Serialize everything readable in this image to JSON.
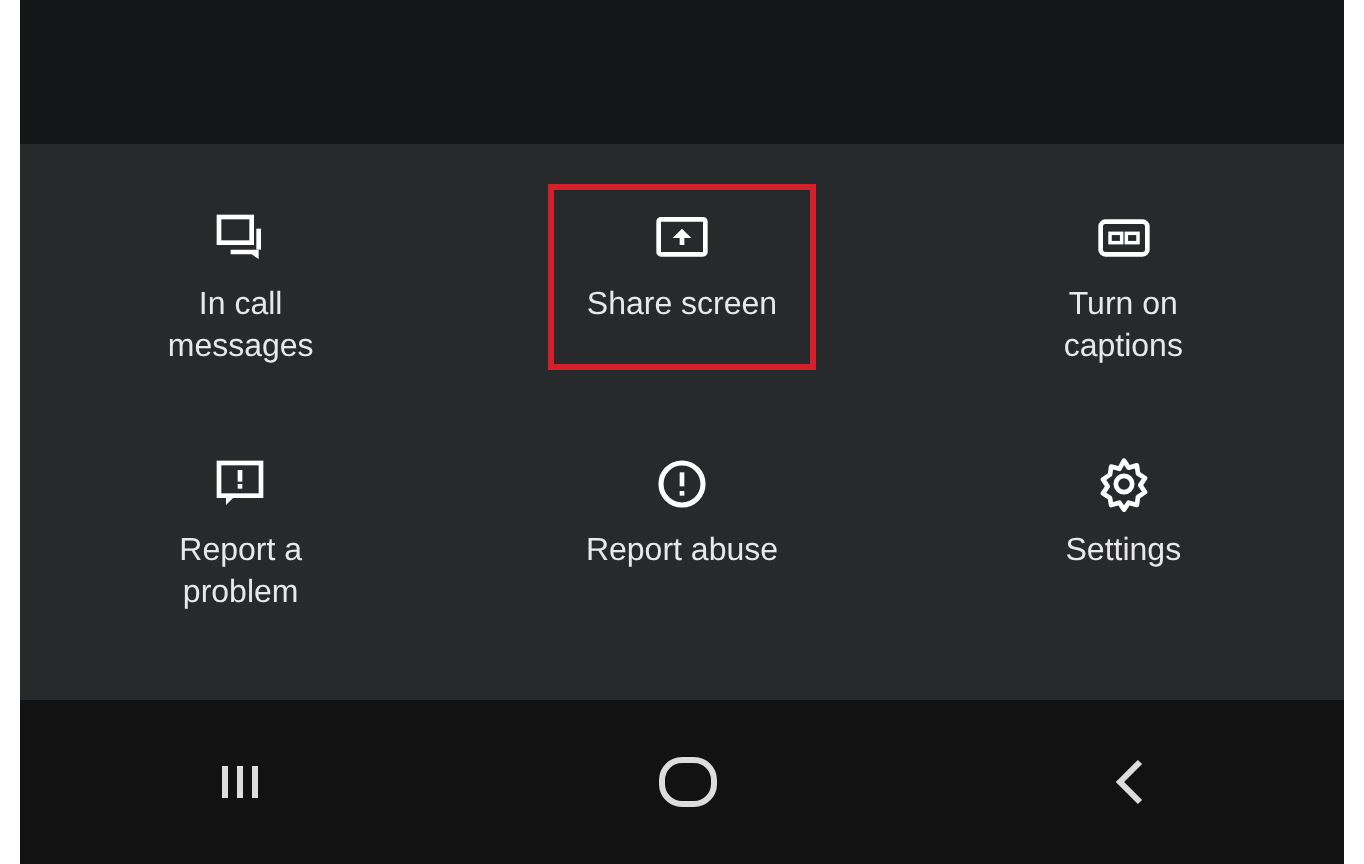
{
  "menu": {
    "items": [
      {
        "label": "In call\nmessages",
        "kind": "messages",
        "highlighted": false
      },
      {
        "label": "Share screen",
        "kind": "share",
        "highlighted": true
      },
      {
        "label": "Turn on\ncaptions",
        "kind": "captions",
        "highlighted": false
      },
      {
        "label": "Report a\nproblem",
        "kind": "report",
        "highlighted": false
      },
      {
        "label": "Report abuse",
        "kind": "abuse",
        "highlighted": false
      },
      {
        "label": "Settings",
        "kind": "settings",
        "highlighted": false
      }
    ]
  },
  "nav_bar": {
    "buttons": [
      {
        "kind": "recents"
      },
      {
        "kind": "home"
      },
      {
        "kind": "back"
      }
    ]
  }
}
